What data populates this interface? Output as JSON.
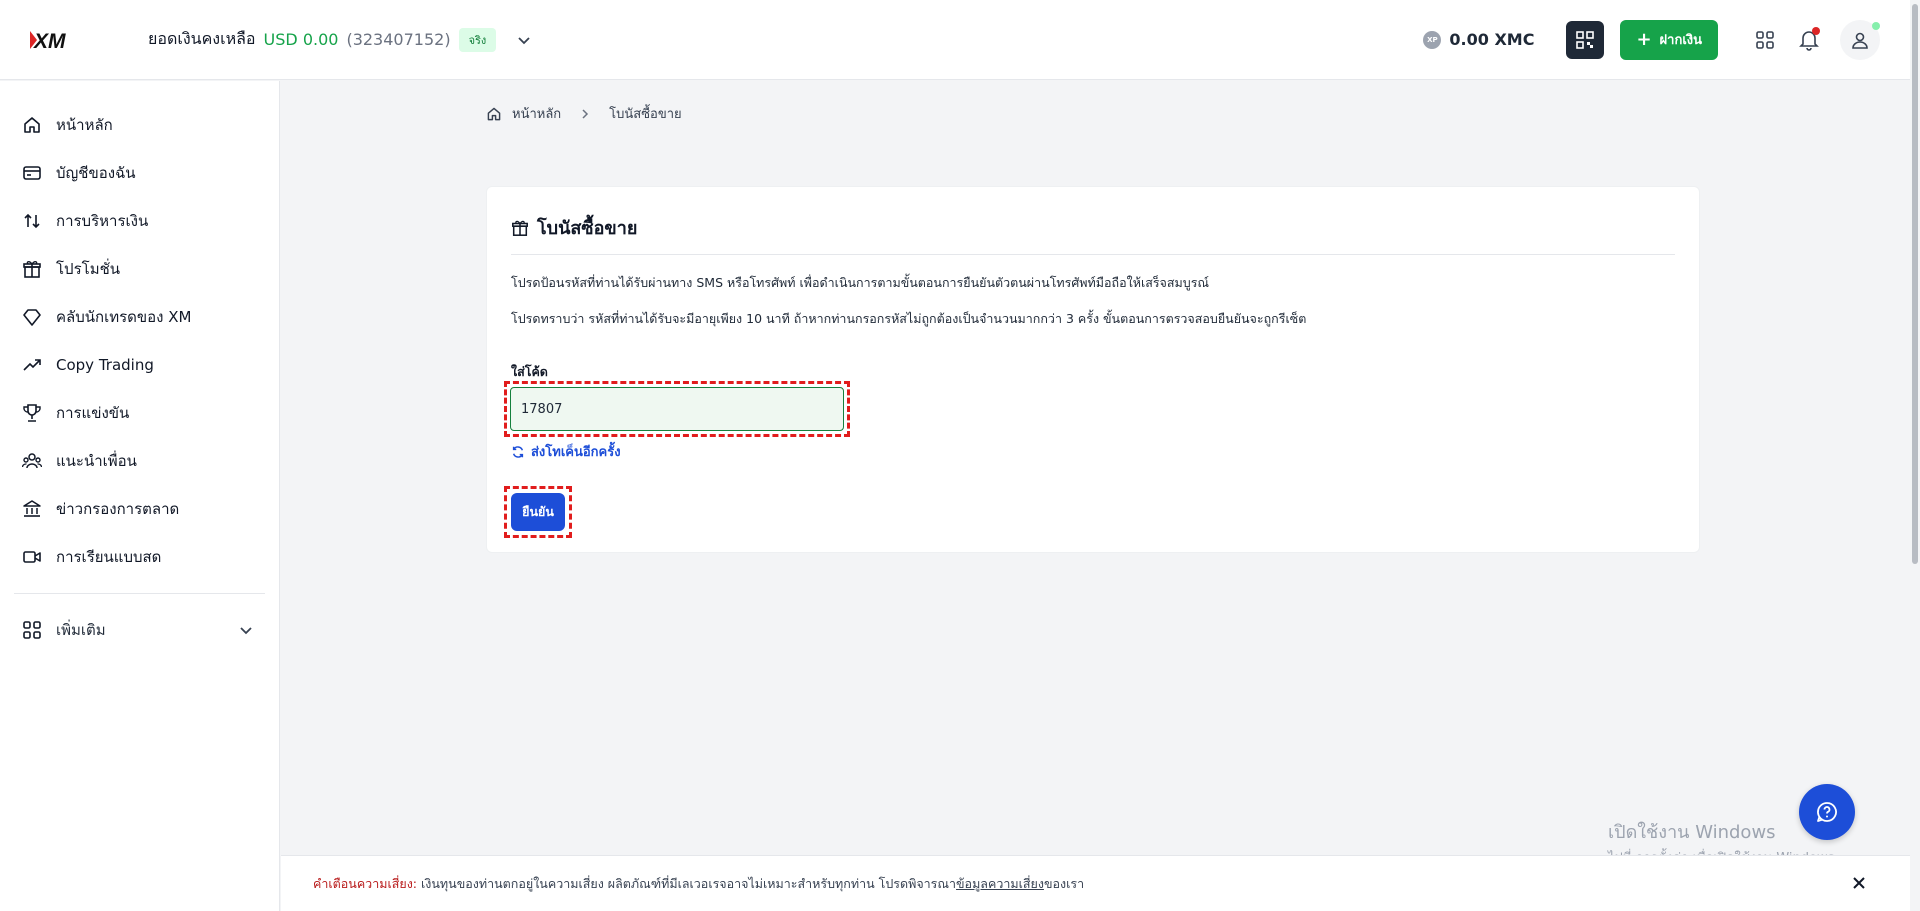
{
  "header": {
    "logo_text": "XM",
    "balance_label": "ยอดเงินคงเหลือ",
    "balance_amount": "USD 0.00",
    "account_number": "(323407152)",
    "account_type": "จริง",
    "xmc_icon_text": "XP",
    "xmc_balance": "0.00 XMC",
    "deposit_label": "ฝากเงิน"
  },
  "sidebar": {
    "items": [
      {
        "label": "หน้าหลัก",
        "icon": "home-icon"
      },
      {
        "label": "บัญชีของฉัน",
        "icon": "card-icon"
      },
      {
        "label": "การบริหารเงิน",
        "icon": "transfer-icon"
      },
      {
        "label": "โปรโมชั่น",
        "icon": "gift-icon"
      },
      {
        "label": "คลับนักเทรดของ XM",
        "icon": "diamond-icon"
      },
      {
        "label": "Copy Trading",
        "icon": "trending-up-icon"
      },
      {
        "label": "การแข่งขัน",
        "icon": "trophy-icon"
      },
      {
        "label": "แนะนำเพื่อน",
        "icon": "users-icon"
      },
      {
        "label": "ข่าวกรองการตลาด",
        "icon": "bank-icon"
      },
      {
        "label": "การเรียนแบบสด",
        "icon": "video-icon"
      }
    ],
    "more_label": "เพิ่มเติม"
  },
  "breadcrumb": {
    "home": "หน้าหลัก",
    "current": "โบนัสซื้อขาย"
  },
  "card": {
    "title": "โบนัสซื้อขาย",
    "instruction_1": "โปรดป้อนรหัสที่ท่านได้รับผ่านทาง SMS หรือโทรศัพท์ เพื่อดำเนินการตามขั้นตอนการยืนยันตัวตนผ่านโทรศัพท์มือถือให้เสร็จสมบูรณ์",
    "instruction_2": "โปรดทราบว่า รหัสที่ท่านได้รับจะมีอายุเพียง 10 นาที ถ้าหากท่านกรอกรหัสไม่ถูกต้องเป็นจำนวนมากกว่า 3 ครั้ง ขั้นตอนการตรวจสอบยืนยันจะถูกรีเซ็ต",
    "code_label": "ใส่โค้ด",
    "code_value": "17807",
    "resend_label": "ส่งโทเค็นอีกครั้ง",
    "confirm_label": "ยืนยัน"
  },
  "warning": {
    "label": "คำเตือนความเสี่ยง:",
    "text": "เงินทุนของท่านตกอยู่ในความเสี่ยง ผลิตภัณฑ์ที่มีเลเวอเรจอาจไม่เหมาะสำหรับทุกท่าน โปรดพิจารณา",
    "link": "ข้อมูลความเสี่ยง",
    "suffix": "ของเรา"
  },
  "watermark": {
    "line1": "เปิดใช้งาน Windows",
    "line2": "ไปที่ การตั้งค่า เพื่อเปิดใช้งาน Windows"
  },
  "colors": {
    "brand_green": "#16a34a",
    "primary_blue": "#1d4ed8",
    "highlight_red": "#e11d1d"
  }
}
